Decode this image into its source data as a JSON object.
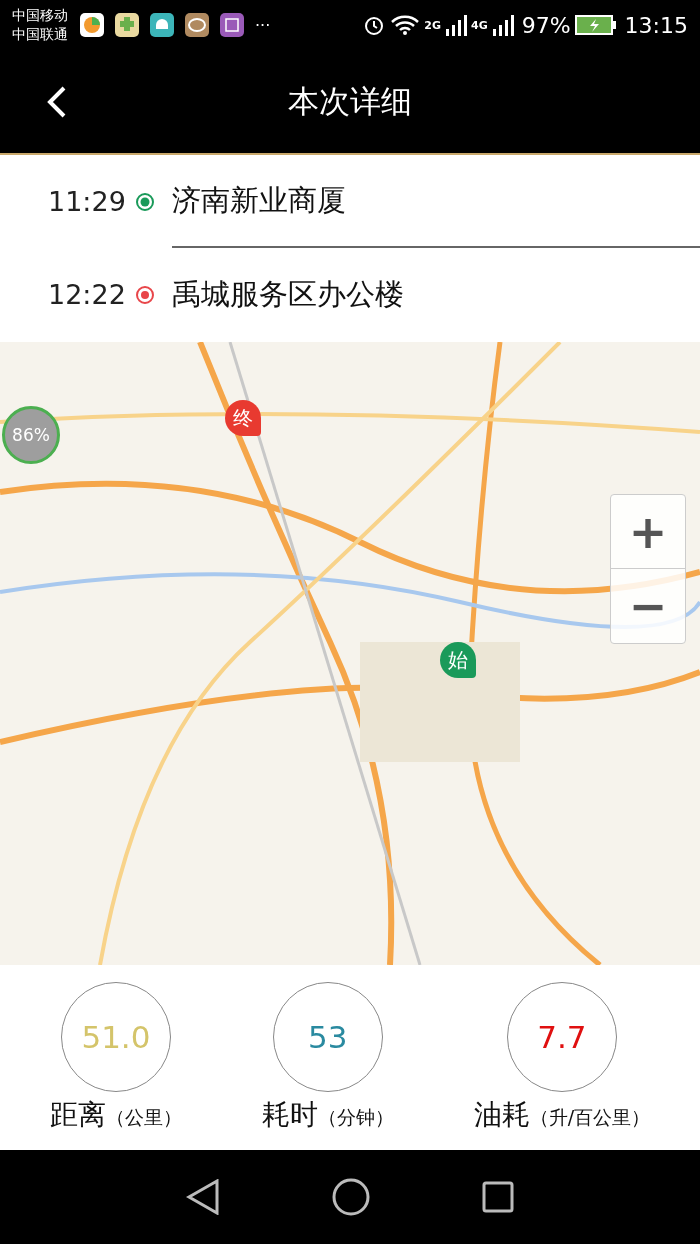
{
  "status_bar": {
    "carriers": [
      "中国移动",
      "中国联通"
    ],
    "more": "···",
    "network_labels": [
      "2G",
      "4G"
    ],
    "battery": "97%",
    "time": "13:15"
  },
  "header": {
    "title": "本次详细"
  },
  "stops": [
    {
      "time": "11:29",
      "name": "济南新业商厦",
      "kind": "start",
      "color": "#1a9a5a"
    },
    {
      "time": "12:22",
      "name": "禹城服务区办公楼",
      "kind": "end",
      "color": "#e8464a"
    }
  ],
  "map": {
    "start_marker": "始",
    "end_marker": "终",
    "badge": "86%",
    "zoom_in": "+",
    "zoom_out": "−"
  },
  "stats": [
    {
      "value": "51.0",
      "color": "#d4c46a",
      "label": "距离",
      "unit": "（公里）"
    },
    {
      "value": "53",
      "color": "#2a8aa0",
      "label": "耗时",
      "unit": "（分钟）"
    },
    {
      "value": "7.7",
      "color": "#e01010",
      "label": "油耗",
      "unit": "（升/百公里）"
    }
  ]
}
